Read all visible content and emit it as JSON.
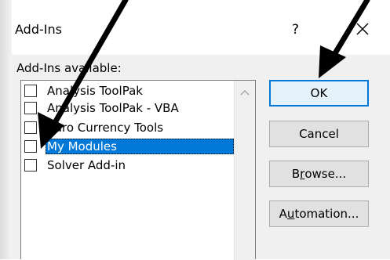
{
  "dialog": {
    "title": "Add-Ins",
    "help_label": "?",
    "group_label": "Add-Ins available:"
  },
  "addins": [
    {
      "label": "Analysis ToolPak",
      "checked": false,
      "selected": false
    },
    {
      "label": "Analysis ToolPak - VBA",
      "checked": false,
      "selected": false
    },
    {
      "label": "Euro Currency Tools",
      "checked": false,
      "selected": false
    },
    {
      "label": "My Modules",
      "checked": false,
      "selected": true
    },
    {
      "label": "Solver Add-in",
      "checked": false,
      "selected": false
    }
  ],
  "buttons": {
    "ok": "OK",
    "cancel": "Cancel",
    "browse_prefix": "B",
    "browse_accel": "r",
    "browse_rest": "owse...",
    "automation_prefix": "A",
    "automation_accel": "u",
    "automation_rest": "tomation..."
  },
  "colors": {
    "selection": "#0078d7",
    "annotation_arrow": "#000000"
  }
}
